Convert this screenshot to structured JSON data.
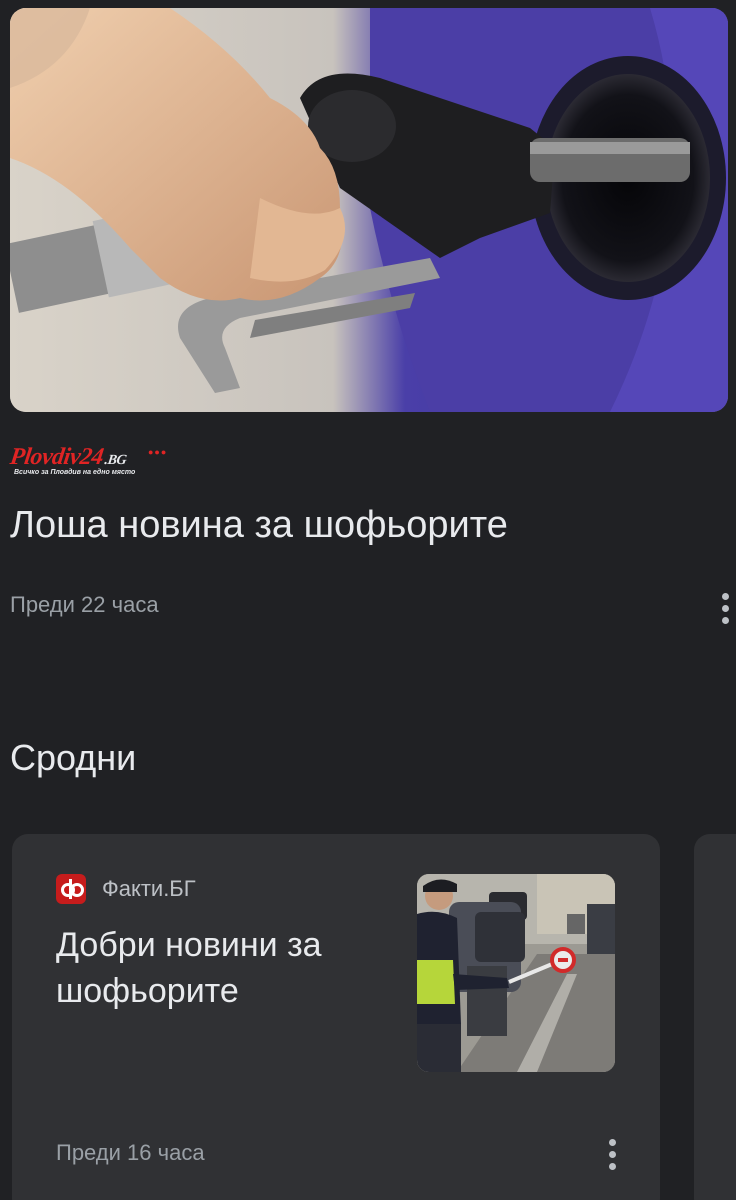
{
  "article": {
    "source_name": "Plovdiv24",
    "source_domain": ".BG",
    "source_tagline": "Всичко за Пловдив на едно място",
    "title": "Лоша новина за шофьорите",
    "time": "Преди 22 часа"
  },
  "related": {
    "heading": "Сродни",
    "cards": [
      {
        "source": "Факти.БГ",
        "title": "Добри новини за шофьорите",
        "time": "Преди 16 часа"
      }
    ]
  },
  "colors": {
    "background": "#202124",
    "card": "#303134",
    "brand_red": "#e02424"
  },
  "icons": {
    "more": "more-vertical-icon",
    "source": "fakti-logo-icon"
  }
}
